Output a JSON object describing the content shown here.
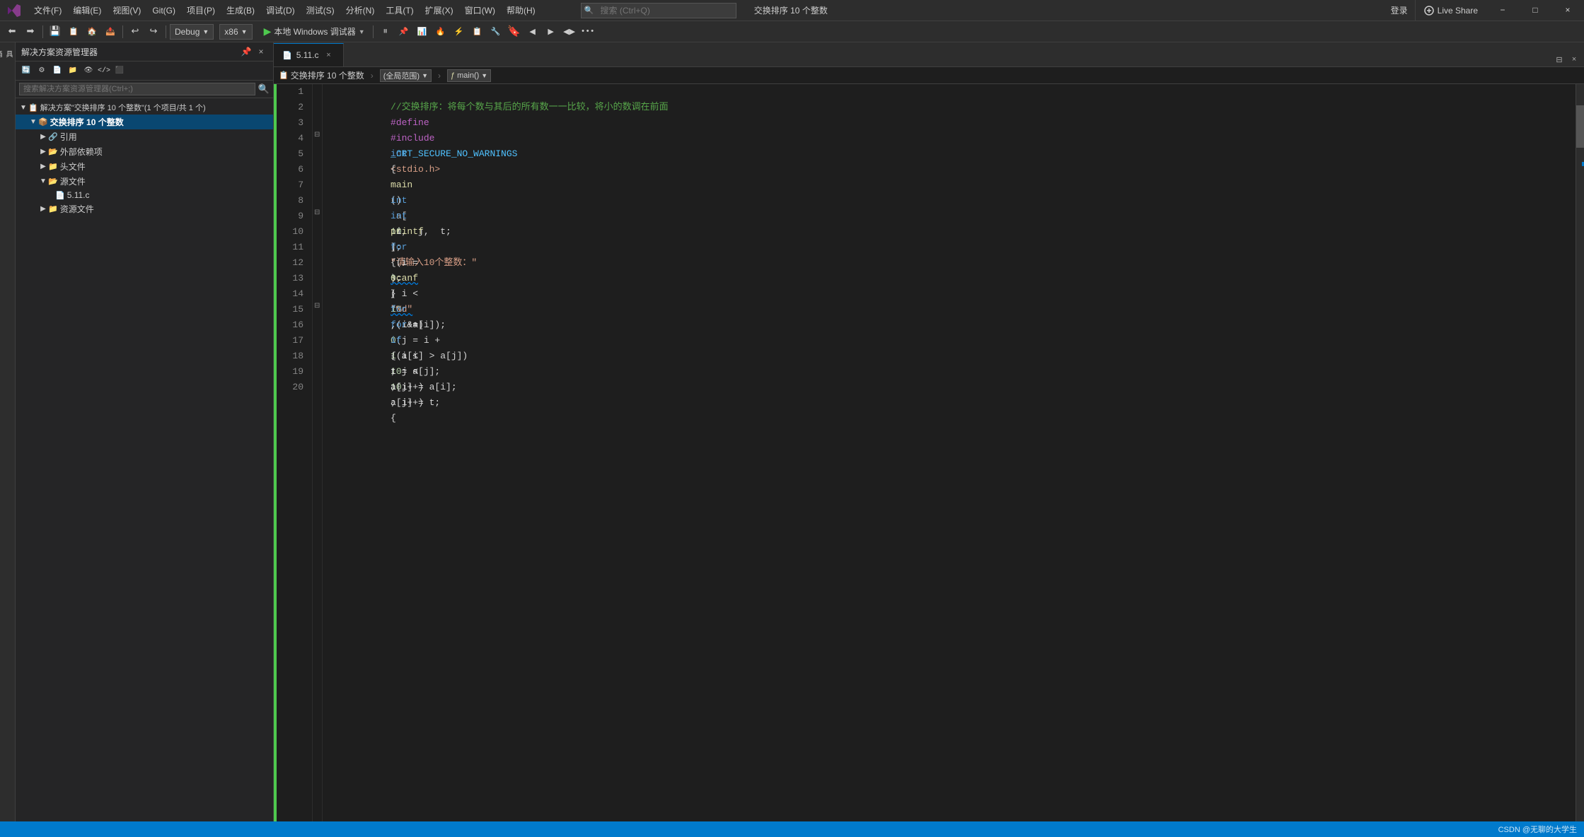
{
  "titlebar": {
    "logo": "▶",
    "menus": [
      "文件(F)",
      "编辑(E)",
      "视图(V)",
      "Git(G)",
      "项目(P)",
      "生成(B)",
      "调试(D)",
      "测试(S)",
      "分析(N)",
      "工具(T)",
      "扩展(X)",
      "窗口(W)",
      "帮助(H)"
    ],
    "search_placeholder": "搜索 (Ctrl+Q)",
    "search_icon": "🔍",
    "title": "交换排序 10 个整数",
    "login": "登录",
    "live_share": "Live Share",
    "win_min": "−",
    "win_max": "□",
    "win_close": "×"
  },
  "toolbar": {
    "back_btn": "←",
    "fwd_btn": "→",
    "save_icon": "💾",
    "undo": "↩",
    "redo": "↪",
    "debug_config": "Debug",
    "arch": "x86",
    "run_label": "本地 Windows 调试器",
    "debug_target_arrow": "▼"
  },
  "sidebar": {
    "header": "解决方案资源管理器",
    "search_placeholder": "搜索解决方案资源管理器(Ctrl+;)",
    "solution_label": "解决方案\"交换排序 10 个整数\"(1 个项目/共 1 个)",
    "project_label": "交换排序 10 个整数",
    "tree_items": [
      {
        "label": "引用",
        "icon": "ref",
        "indent": 2,
        "expanded": false
      },
      {
        "label": "外部依赖项",
        "icon": "deps",
        "indent": 2,
        "expanded": false
      },
      {
        "label": "头文件",
        "icon": "folder",
        "indent": 2,
        "expanded": false
      },
      {
        "label": "源文件",
        "icon": "folder",
        "indent": 2,
        "expanded": true
      },
      {
        "label": "5.11.c",
        "icon": "file-c",
        "indent": 3,
        "expanded": false
      },
      {
        "label": "资源文件",
        "icon": "folder",
        "indent": 2,
        "expanded": false
      }
    ]
  },
  "editor": {
    "tabs": [
      {
        "label": "5.11.c",
        "active": false
      },
      {
        "label": "×",
        "active": true,
        "is_active_marker": true
      }
    ],
    "tab_filename": "5.11.c",
    "breadcrumb_project": "交换排序 10 个整数",
    "breadcrumb_scope": "(全局范围)",
    "breadcrumb_func": "main()",
    "breadcrumb_scope_label": "(全局范围)",
    "func_dropdown_label": "main()"
  },
  "code": {
    "lines": [
      {
        "n": 1,
        "html": "comment",
        "text": "//交换排序：将每个数与其后的所有数一一比较，将小的数调在前面"
      },
      {
        "n": 2,
        "html": "macro",
        "text": "#define  _CRT_SECURE_NO_WARNINGS"
      },
      {
        "n": 3,
        "html": "include",
        "text": "#include <stdio.h>"
      },
      {
        "n": 4,
        "html": "main_sig",
        "text": "int main()"
      },
      {
        "n": 5,
        "html": "plain",
        "text": "{"
      },
      {
        "n": 6,
        "html": "var1",
        "text": "    int a[10];"
      },
      {
        "n": 7,
        "html": "var2",
        "text": "    int i,  j,  t;"
      },
      {
        "n": 8,
        "html": "printf1",
        "text": "    printf(\"请输入10个整数：\");"
      },
      {
        "n": 9,
        "html": "for1",
        "text": "    for (i = 0; i < 10; i++)"
      },
      {
        "n": 10,
        "html": "plain",
        "text": "    {"
      },
      {
        "n": 11,
        "html": "scanf1",
        "text": "        scanf(\"%d\",  &a[i]);"
      },
      {
        "n": 12,
        "html": "plain",
        "text": "    }"
      },
      {
        "n": 13,
        "html": "for2",
        "text": "    for (i = 0; i < 10; i++)"
      },
      {
        "n": 14,
        "html": "for3",
        "text": "        for (j = i + 1; j < 10; j++)"
      },
      {
        "n": 15,
        "html": "if1",
        "text": "            if (a[i] > a[j])"
      },
      {
        "n": 16,
        "html": "plain",
        "text": "            {"
      },
      {
        "n": 17,
        "html": "assign1",
        "text": "                t = a[j];"
      },
      {
        "n": 18,
        "html": "assign2",
        "text": "                a[j] = a[i];"
      },
      {
        "n": 19,
        "html": "assign3",
        "text": "                a[i] = t;"
      },
      {
        "n": 20,
        "html": "plain",
        "text": "            {"
      }
    ]
  },
  "statusbar": {
    "watermark": "CSDN @无聊的大学生"
  }
}
